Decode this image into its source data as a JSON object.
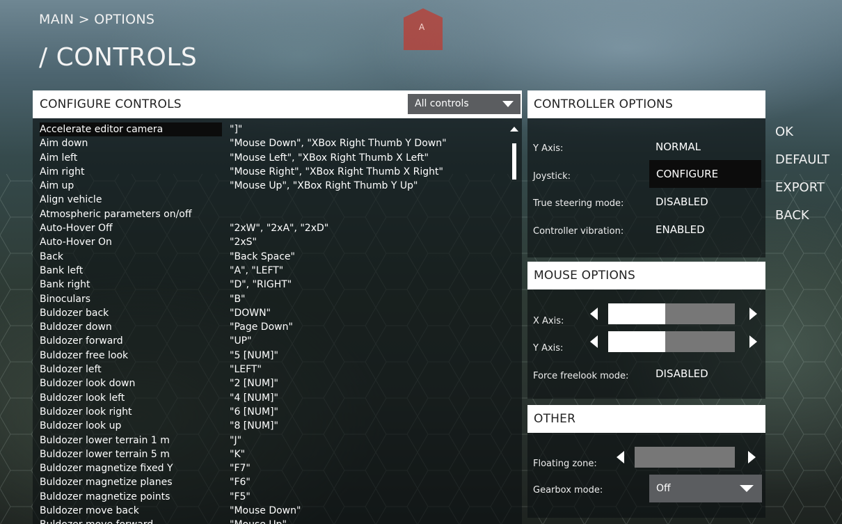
{
  "header": {
    "breadcrumb": "MAIN > OPTIONS",
    "title": "/ CONTROLS"
  },
  "map_marker": {
    "label": "A"
  },
  "configure_controls": {
    "title": "CONFIGURE CONTROLS",
    "filter": {
      "selected": "All controls"
    },
    "rows": [
      {
        "name": "Accelerate editor camera",
        "binding": "\"]\""
      },
      {
        "name": "Aim down",
        "binding": "\"Mouse Down\", \"XBox Right Thumb Y Down\""
      },
      {
        "name": "Aim left",
        "binding": "\"Mouse Left\", \"XBox Right Thumb X Left\""
      },
      {
        "name": "Aim right",
        "binding": "\"Mouse Right\", \"XBox Right Thumb X Right\""
      },
      {
        "name": "Aim up",
        "binding": "\"Mouse Up\", \"XBox Right Thumb Y Up\""
      },
      {
        "name": "Align vehicle",
        "binding": ""
      },
      {
        "name": "Atmospheric parameters on/off",
        "binding": ""
      },
      {
        "name": "Auto-Hover Off",
        "binding": "\"2xW\", \"2xA\", \"2xD\""
      },
      {
        "name": "Auto-Hover On",
        "binding": "\"2xS\""
      },
      {
        "name": "Back",
        "binding": "\"Back Space\""
      },
      {
        "name": "Bank left",
        "binding": "\"A\", \"LEFT\""
      },
      {
        "name": "Bank right",
        "binding": "\"D\", \"RIGHT\""
      },
      {
        "name": "Binoculars",
        "binding": "\"B\""
      },
      {
        "name": "Buldozer back",
        "binding": "\"DOWN\""
      },
      {
        "name": "Buldozer down",
        "binding": "\"Page Down\""
      },
      {
        "name": "Buldozer forward",
        "binding": "\"UP\""
      },
      {
        "name": "Buldozer free look",
        "binding": "\"5 [NUM]\""
      },
      {
        "name": "Buldozer left",
        "binding": "\"LEFT\""
      },
      {
        "name": "Buldozer look down",
        "binding": "\"2 [NUM]\""
      },
      {
        "name": "Buldozer look left",
        "binding": "\"4 [NUM]\""
      },
      {
        "name": "Buldozer look right",
        "binding": "\"6 [NUM]\""
      },
      {
        "name": "Buldozer look up",
        "binding": "\"8 [NUM]\""
      },
      {
        "name": "Buldozer lower terrain 1 m",
        "binding": "\"J\""
      },
      {
        "name": "Buldozer lower terrain 5 m",
        "binding": "\"K\""
      },
      {
        "name": "Buldozer magnetize fixed Y",
        "binding": "\"F7\""
      },
      {
        "name": "Buldozer magnetize planes",
        "binding": "\"F6\""
      },
      {
        "name": "Buldozer magnetize points",
        "binding": "\"F5\""
      },
      {
        "name": "Buldozer move back",
        "binding": "\"Mouse Down\""
      },
      {
        "name": "Buldozer move forward",
        "binding": "\"Mouse Up\""
      }
    ]
  },
  "controller_options": {
    "title": "CONTROLLER OPTIONS",
    "y_axis": {
      "label": "Y Axis:",
      "value": "NORMAL"
    },
    "joystick": {
      "label": "Joystick:",
      "value": "CONFIGURE"
    },
    "true_steering": {
      "label": "True steering mode:",
      "value": "DISABLED"
    },
    "vibration": {
      "label": "Controller vibration:",
      "value": "ENABLED"
    }
  },
  "mouse_options": {
    "title": "MOUSE OPTIONS",
    "x_axis": {
      "label": "X Axis:",
      "level": 0.45
    },
    "y_axis": {
      "label": "Y Axis:",
      "level": 0.45
    },
    "force_freelook": {
      "label": "Force freelook mode:",
      "value": "DISABLED"
    }
  },
  "other": {
    "title": "OTHER",
    "floating_zone": {
      "label": "Floating zone:",
      "level": 0.0
    },
    "gearbox": {
      "label": "Gearbox mode:",
      "value": "Off"
    }
  },
  "side_menu": [
    "OK",
    "DEFAULT",
    "EXPORT",
    "BACK"
  ]
}
